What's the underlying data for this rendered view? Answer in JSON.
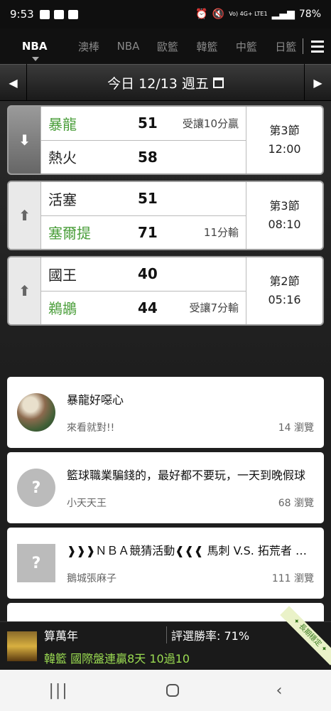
{
  "status_bar": {
    "time": "9:53",
    "network": "Vo) 4G+\nLTE1",
    "battery": "78%"
  },
  "league_tabs": [
    {
      "label": "NBA",
      "active": true
    },
    {
      "label": "澳棒"
    },
    {
      "label": "NBA"
    },
    {
      "label": "歐籃"
    },
    {
      "label": "韓籃"
    },
    {
      "label": "中籃"
    },
    {
      "label": "日籃"
    }
  ],
  "date_bar": {
    "text": "今日 12/13 週五"
  },
  "games": [
    {
      "arrow": "down",
      "status": "第3節",
      "clock": "12:00",
      "home": {
        "name": "暴龍",
        "score": "51",
        "note": "受讓10分贏",
        "green": true
      },
      "away": {
        "name": "熱火",
        "score": "58",
        "note": "",
        "green": false
      }
    },
    {
      "arrow": "up",
      "status": "第3節",
      "clock": "08:10",
      "home": {
        "name": "活塞",
        "score": "51",
        "note": "",
        "green": false
      },
      "away": {
        "name": "塞爾提",
        "score": "71",
        "note": "11分輸",
        "green": true
      }
    },
    {
      "arrow": "up",
      "status": "第2節",
      "clock": "05:16",
      "home": {
        "name": "國王",
        "score": "40",
        "note": "",
        "green": false
      },
      "away": {
        "name": "鵜鶘",
        "score": "44",
        "note": "受讓7分輸",
        "green": true
      }
    }
  ],
  "posts": [
    {
      "title": "暴龍好噁心",
      "author": "來看就對!!",
      "views": "14 瀏覽",
      "avatar": "photo"
    },
    {
      "title": "籃球職業騙錢的，最好都不要玩，一天到晚假球",
      "author": "小天天王",
      "views": "68 瀏覽",
      "avatar": "default-round"
    },
    {
      "title": "❱❱❱ＮＢＡ競猜活動❰❰❰ 馬刺 V.S. 拓荒者 預測賽果",
      "author": "鵝城張麻子",
      "views": "111 瀏覽",
      "avatar": "default-square"
    }
  ],
  "ad": {
    "user": "算萬年",
    "rate": "評選勝率: 71%",
    "record": "韓籃 國際盤連贏8天 10過10",
    "badge": "✦ 長期穩定 ✦"
  },
  "nav": {
    "recent": "|||",
    "back": "‹"
  },
  "colors": {
    "win_green": "#4a9e3a",
    "ad_green": "#9bdc52"
  }
}
